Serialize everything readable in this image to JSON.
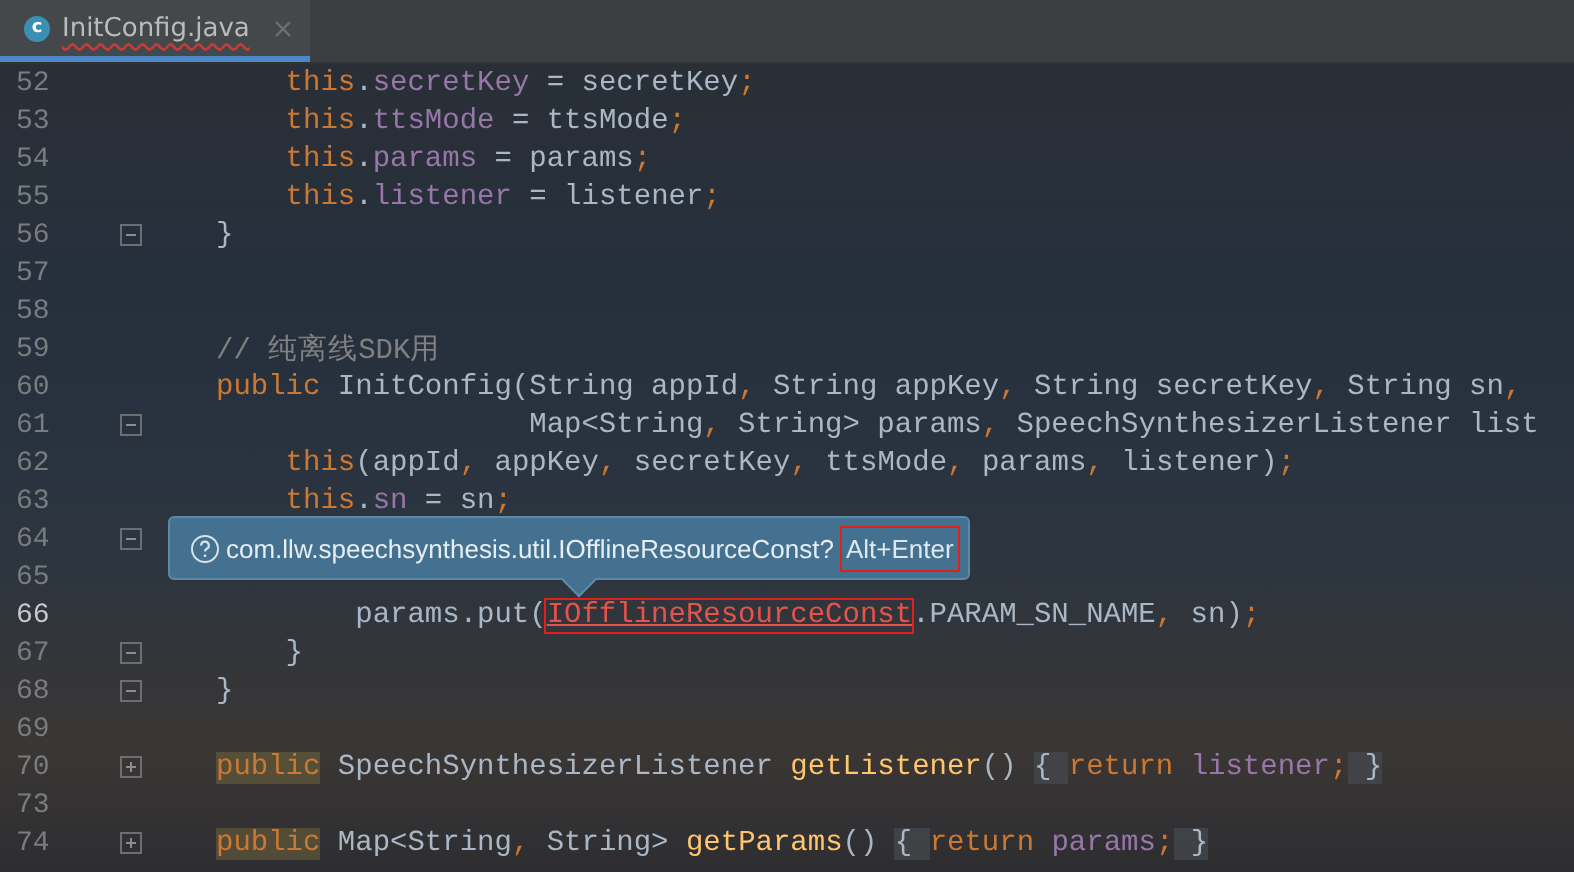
{
  "tab": {
    "label": "InitConfig.java",
    "icon_letter": "c",
    "selected": true
  },
  "lines": [
    {
      "number": "52",
      "code": [
        {
          "kind": "kw",
          "text": "    this"
        },
        {
          "kind": "plain",
          "text": "."
        },
        {
          "kind": "field",
          "text": "secretKey"
        },
        {
          "kind": "plain",
          "text": " = secretKey"
        },
        {
          "kind": "punct",
          "text": ";"
        }
      ]
    },
    {
      "number": "53",
      "code": [
        {
          "kind": "kw",
          "text": "    this"
        },
        {
          "kind": "plain",
          "text": "."
        },
        {
          "kind": "field",
          "text": "ttsMode"
        },
        {
          "kind": "plain",
          "text": " = ttsMode"
        },
        {
          "kind": "punct",
          "text": ";"
        }
      ]
    },
    {
      "number": "54",
      "code": [
        {
          "kind": "kw",
          "text": "    this"
        },
        {
          "kind": "plain",
          "text": "."
        },
        {
          "kind": "field",
          "text": "params"
        },
        {
          "kind": "plain",
          "text": " = params"
        },
        {
          "kind": "punct",
          "text": ";"
        }
      ]
    },
    {
      "number": "55",
      "code": [
        {
          "kind": "kw",
          "text": "    this"
        },
        {
          "kind": "plain",
          "text": "."
        },
        {
          "kind": "field",
          "text": "listener"
        },
        {
          "kind": "plain",
          "text": " = listener"
        },
        {
          "kind": "punct",
          "text": ";"
        }
      ]
    },
    {
      "number": "56",
      "fold_marker": true,
      "collapsed": false,
      "code": [
        {
          "kind": "plain",
          "text": "}"
        }
      ]
    },
    {
      "number": "57"
    },
    {
      "number": "58"
    },
    {
      "number": "59",
      "code": [
        {
          "kind": "comment",
          "text": "// 纯离线SDK用"
        }
      ]
    },
    {
      "number": "60",
      "code": [
        {
          "kind": "kw",
          "text": "public "
        },
        {
          "kind": "plain",
          "text": "InitConfig(String appId"
        },
        {
          "kind": "punct",
          "text": ", "
        },
        {
          "kind": "plain",
          "text": "String appKey"
        },
        {
          "kind": "punct",
          "text": ", "
        },
        {
          "kind": "plain",
          "text": "String secretKey"
        },
        {
          "kind": "punct",
          "text": ", "
        },
        {
          "kind": "plain",
          "text": "String sn"
        },
        {
          "kind": "punct",
          "text": ","
        }
      ]
    },
    {
      "number": "61",
      "fold_marker": true,
      "collapsed": false,
      "code": [
        {
          "kind": "plain",
          "text": "                  Map<String"
        },
        {
          "kind": "punct",
          "text": ", "
        },
        {
          "kind": "plain",
          "text": "String> params"
        },
        {
          "kind": "punct",
          "text": ", "
        },
        {
          "kind": "plain",
          "text": "SpeechSynthesizerListener list"
        }
      ]
    },
    {
      "number": "62",
      "code": [
        {
          "kind": "kw",
          "text": "    this"
        },
        {
          "kind": "plain",
          "text": "(appId"
        },
        {
          "kind": "punct",
          "text": ", "
        },
        {
          "kind": "plain",
          "text": "appKey"
        },
        {
          "kind": "punct",
          "text": ", "
        },
        {
          "kind": "plain",
          "text": "secretKey"
        },
        {
          "kind": "punct",
          "text": ", "
        },
        {
          "kind": "plain",
          "text": "ttsMode"
        },
        {
          "kind": "punct",
          "text": ", "
        },
        {
          "kind": "plain",
          "text": "params"
        },
        {
          "kind": "punct",
          "text": ", "
        },
        {
          "kind": "plain",
          "text": "listener)"
        },
        {
          "kind": "punct",
          "text": ";"
        }
      ]
    },
    {
      "number": "63",
      "code": [
        {
          "kind": "kw",
          "text": "    this"
        },
        {
          "kind": "plain",
          "text": "."
        },
        {
          "kind": "field",
          "text": "sn"
        },
        {
          "kind": "plain",
          "text": " = sn"
        },
        {
          "kind": "punct",
          "text": ";"
        }
      ]
    },
    {
      "number": "64",
      "fold_marker": true,
      "collapsed": false
    },
    {
      "number": "65"
    },
    {
      "number": "66",
      "current": true,
      "code": [
        {
          "kind": "plain",
          "text": "        params.put("
        },
        {
          "kind": "error",
          "text": "IOfflineResourceConst"
        },
        {
          "kind": "plain",
          "text": ".PARAM_SN_NAME"
        },
        {
          "kind": "punct",
          "text": ", "
        },
        {
          "kind": "plain",
          "text": "sn)"
        },
        {
          "kind": "punct",
          "text": ";"
        }
      ]
    },
    {
      "number": "67",
      "fold_marker": true,
      "collapsed": false,
      "code": [
        {
          "kind": "plain",
          "text": "    }"
        }
      ]
    },
    {
      "number": "68",
      "fold_marker": true,
      "collapsed": false,
      "code": [
        {
          "kind": "plain",
          "text": "}"
        }
      ]
    },
    {
      "number": "69"
    },
    {
      "number": "70",
      "fold_marker": true,
      "collapsed": true,
      "code": [
        {
          "kind": "usage",
          "text": "public"
        },
        {
          "kind": "plain",
          "text": " SpeechSynthesizerListener "
        },
        {
          "kind": "method",
          "text": "getListener"
        },
        {
          "kind": "plain",
          "text": "() "
        },
        {
          "kind": "folded",
          "text": "{ "
        },
        {
          "kind": "kw",
          "text": "return "
        },
        {
          "kind": "field",
          "text": "listener"
        },
        {
          "kind": "punct",
          "text": ";"
        },
        {
          "kind": "folded",
          "text": " }"
        }
      ]
    },
    {
      "number": "73"
    },
    {
      "number": "74",
      "fold_marker": true,
      "collapsed": true,
      "code": [
        {
          "kind": "usage",
          "text": "public"
        },
        {
          "kind": "plain",
          "text": " Map<String"
        },
        {
          "kind": "punct",
          "text": ", "
        },
        {
          "kind": "plain",
          "text": "String> "
        },
        {
          "kind": "method",
          "text": "getParams"
        },
        {
          "kind": "plain",
          "text": "() "
        },
        {
          "kind": "folded",
          "text": "{ "
        },
        {
          "kind": "kw",
          "text": "return "
        },
        {
          "kind": "field",
          "text": "params"
        },
        {
          "kind": "punct",
          "text": ";"
        },
        {
          "kind": "folded",
          "text": " }"
        }
      ]
    }
  ],
  "tooltip": {
    "text": "com.llw.speechsynthesis.util.IOfflineResourceConst?",
    "shortcut": "Alt+Enter"
  }
}
